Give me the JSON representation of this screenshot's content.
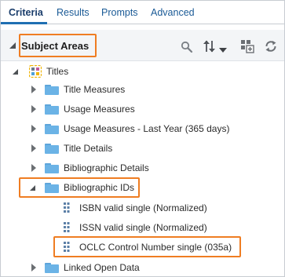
{
  "tabs": [
    {
      "label": "Criteria",
      "active": true
    },
    {
      "label": "Results",
      "active": false
    },
    {
      "label": "Prompts",
      "active": false
    },
    {
      "label": "Advanced",
      "active": false
    }
  ],
  "panel": {
    "title": "Subject Areas",
    "highlight_color": "#ef7d22"
  },
  "toolbar_icons": [
    "search-icon",
    "sort-icon",
    "chevron-down-icon",
    "add-subject-area-icon",
    "refresh-icon"
  ],
  "tree": {
    "root": {
      "label": "Titles",
      "icon": "subject-area-icon"
    },
    "folders": [
      {
        "label": "Title Measures",
        "expanded": false
      },
      {
        "label": "Usage Measures",
        "expanded": false
      },
      {
        "label": "Usage Measures - Last Year (365 days)",
        "expanded": false
      },
      {
        "label": "Title Details",
        "expanded": false
      },
      {
        "label": "Bibliographic Details",
        "expanded": false
      },
      {
        "label": "Bibliographic IDs",
        "expanded": true,
        "highlighted": true
      },
      {
        "label": "Linked Open Data",
        "expanded": false
      }
    ],
    "columns": [
      {
        "label": "ISBN valid single (Normalized)",
        "highlighted": false
      },
      {
        "label": "ISSN valid single (Normalized)",
        "highlighted": false
      },
      {
        "label": "OCLC Control Number single (035a)",
        "highlighted": true
      }
    ]
  },
  "colors": {
    "accent": "#1f6fb2",
    "folder": "#6bb3e6",
    "highlight": "#ef7d22"
  }
}
